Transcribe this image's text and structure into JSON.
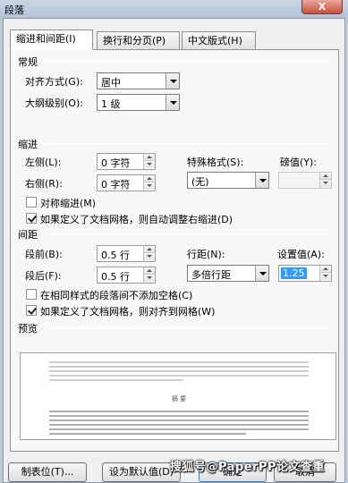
{
  "window": {
    "title": "段落",
    "close_label": "X"
  },
  "tabs": [
    {
      "label": "缩进和间距(I)",
      "active": true
    },
    {
      "label": "换行和分页(P)",
      "active": false
    },
    {
      "label": "中文版式(H)",
      "active": false
    }
  ],
  "general": {
    "section_label": "常规",
    "alignment_label": "对齐方式(G):",
    "alignment_value": "居中",
    "outline_label": "大纲级别(O):",
    "outline_value": "1 级"
  },
  "indent": {
    "section_label": "缩进",
    "left_label": "左侧(L):",
    "left_value": "0 字符",
    "right_label": "右侧(R):",
    "right_value": "0 字符",
    "special_label": "特殊格式(S):",
    "special_value": "(无)",
    "by_label": "磅值(Y):",
    "by_value": "",
    "mirror_label": "对称缩进(M)",
    "mirror_checked": false,
    "auto_adjust_label": "如果定义了文档网格，则自动调整右缩进(D)",
    "auto_adjust_checked": true
  },
  "spacing": {
    "section_label": "间距",
    "before_label": "段前(B):",
    "before_value": "0.5 行",
    "after_label": "段后(F):",
    "after_value": "0.5 行",
    "line_spacing_label": "行距(N):",
    "line_spacing_value": "多倍行距",
    "at_label": "设置值(A):",
    "at_value": "1.25",
    "no_space_label": "在相同样式的段落间不添加空格(C)",
    "no_space_checked": false,
    "snap_grid_label": "如果定义了文档网格，则对齐到网格(W)",
    "snap_grid_checked": true
  },
  "preview": {
    "section_label": "预览",
    "sample_text": "摘 要"
  },
  "buttons": {
    "tabs_label": "制表位(T)...",
    "default_label": "设为默认值(D)",
    "ok_label": "确定",
    "cancel_label": "取消"
  },
  "watermark": "搜狐号@PaperPP论文查重"
}
